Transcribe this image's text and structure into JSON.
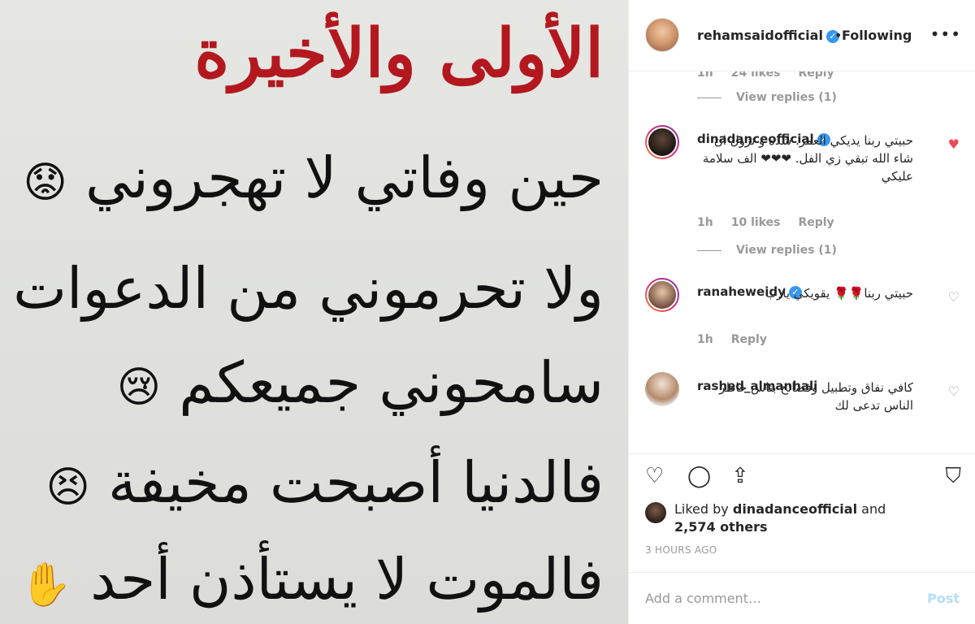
{
  "image_text": {
    "title": "الأولى والأخيرة",
    "line1": "حين وفاتي لا تهجروني",
    "line1_emoji": "😟",
    "line2": "ولا تحرموني من الدعوات",
    "line3": "سامحوني جميعكم",
    "line3_emoji": "😢",
    "line4": "فالدنيا أصبحت مخيفة",
    "line4_emoji": "😣",
    "line5": "فالموت لا يستأذن أحد",
    "line5_emoji": "✋"
  },
  "header": {
    "username": "rehamsaidofficial",
    "verified_mark": "✓",
    "dot": "•",
    "follow_status": "Following",
    "more_icon": "•••"
  },
  "top_meta": {
    "time": "1h",
    "likes": "24 likes",
    "reply": "Reply",
    "view_replies": "View replies (1)"
  },
  "comments": [
    {
      "user": "dinadanceofficial",
      "verified": true,
      "text": "حبيتي ربنا يديكي العمر. شده و تزول ان شاء الله تبقي زي الفل. ❤❤❤ الف سلامة عليكي",
      "time": "1h",
      "likes": "10 likes",
      "reply": "Reply",
      "view_replies": "View replies (1)",
      "liked": true,
      "heart": "♥"
    },
    {
      "user": "ranaheweidy",
      "verified": true,
      "text": "حبيتي ربنا🌹🌹 يقويكي يارب",
      "time": "1h",
      "reply": "Reply",
      "liked": false,
      "heart": "♡"
    },
    {
      "user": "rashed_almanhali",
      "verified": false,
      "text": "كافي نفاق وتطبيل وفضائح بناس خاطر الناس تدعى لك",
      "liked": false,
      "heart": "♡"
    }
  ],
  "actions": {
    "like_icon": "♡",
    "comment_icon": "◯",
    "share_icon": "⇪",
    "save_icon": "⛉"
  },
  "liked_by": {
    "prefix": "Liked by",
    "user": "dinadanceofficial",
    "suffix": "and",
    "others": "2,574 others"
  },
  "timestamp": "3 HOURS AGO",
  "add_comment": {
    "placeholder": "Add a comment…",
    "post_label": "Post"
  }
}
